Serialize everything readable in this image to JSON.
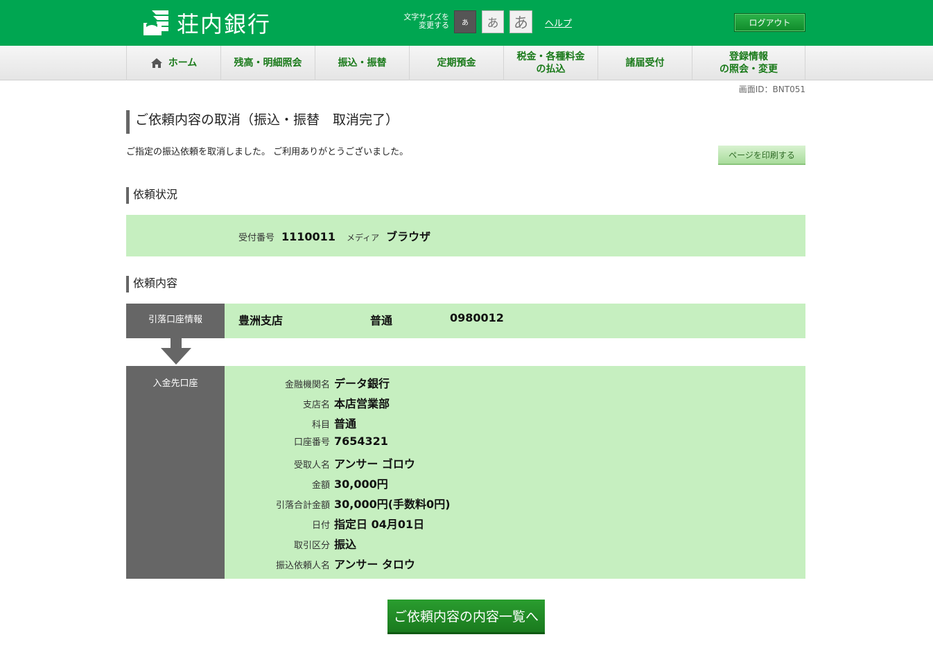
{
  "header": {
    "logo_text": "荘内銀行",
    "fontsize_label_1": "文字サイズを",
    "fontsize_label_2": "変更する",
    "fontsize_small": "あ",
    "fontsize_medium": "あ",
    "fontsize_large": "あ",
    "help": "ヘルプ",
    "logout": "ログアウト"
  },
  "nav": {
    "items": [
      {
        "label": "ホーム"
      },
      {
        "label": "残高・明細照会"
      },
      {
        "label": "振込・振替"
      },
      {
        "label": "定期預金"
      },
      {
        "label_1": "税金・各種料金",
        "label_2": "の払込"
      },
      {
        "label": "諸届受付"
      },
      {
        "label_1": "登録情報",
        "label_2": "の照会・変更"
      }
    ]
  },
  "screen_id": "画面ID：BNT051",
  "page_title": "ご依頼内容の取消（振込・振替　取消完了）",
  "description": "ご指定の振込依頼を取消しました。 ご利用ありがとうございました。",
  "print_button": "ページを印刷する",
  "status": {
    "heading": "依頼状況",
    "receipt_label": "受付番号",
    "receipt_value": "1110011",
    "media_label": "メディア",
    "media_value": "ブラウザ"
  },
  "content": {
    "heading": "依頼内容",
    "from_label": "引落口座情報",
    "from_branch": "豊洲支店",
    "from_type": "普通",
    "from_number": "0980012",
    "to_label": "入金先口座",
    "details": [
      {
        "label": "金融機関名",
        "value": "データ銀行"
      },
      {
        "label": "支店名",
        "value": "本店営業部"
      },
      {
        "label": "科目",
        "value": "普通"
      },
      {
        "label": "口座番号",
        "value": "7654321"
      },
      {
        "label": "受取人名",
        "value": "アンサー ゴロウ"
      },
      {
        "label": "金額",
        "value": "30,000円"
      },
      {
        "label": "引落合計金額",
        "value": "30,000円(手数料0円)"
      },
      {
        "label": "日付",
        "value": "指定日 04月01日"
      },
      {
        "label": "取引区分",
        "value": "振込"
      },
      {
        "label": "振込依頼人名",
        "value": "アンサー タロウ"
      }
    ]
  },
  "back_button": "ご依頼内容の内容一覧へ",
  "colors": {
    "brand": "#00a651",
    "panel": "#c6efc0",
    "label_bg": "#666666"
  }
}
